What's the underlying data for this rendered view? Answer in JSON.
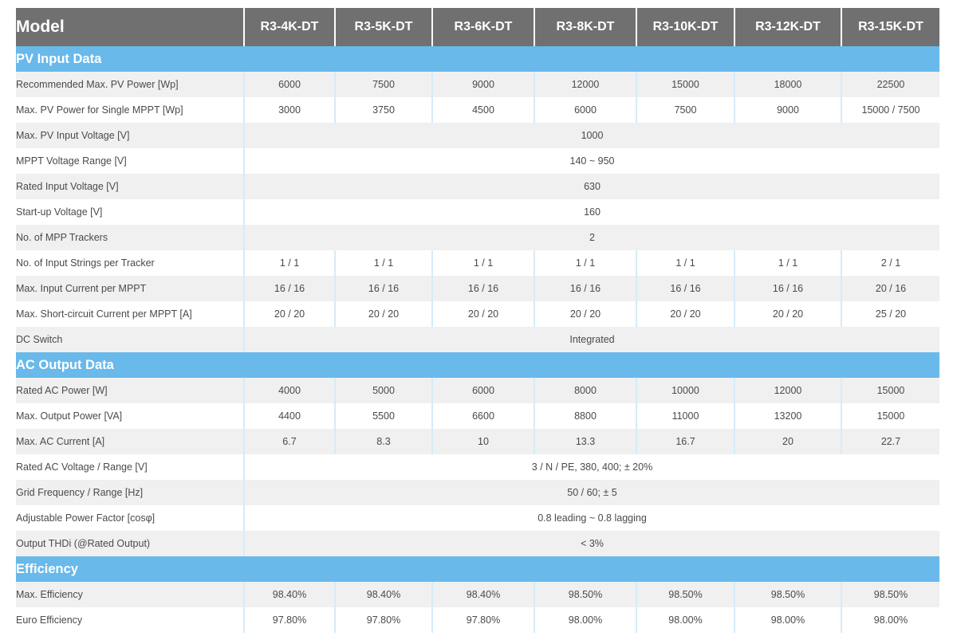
{
  "header": {
    "model_label": "Model",
    "models": [
      "R3-4K-DT",
      "R3-5K-DT",
      "R3-6K-DT",
      "R3-8K-DT",
      "R3-10K-DT",
      "R3-12K-DT",
      "R3-15K-DT"
    ]
  },
  "sections": [
    {
      "title": "PV Input Data",
      "rows": [
        {
          "label": "Recommended Max. PV Power [Wp]",
          "values": [
            "6000",
            "7500",
            "9000",
            "12000",
            "15000",
            "18000",
            "22500"
          ]
        },
        {
          "label": "Max. PV Power for Single MPPT [Wp]",
          "values": [
            "3000",
            "3750",
            "4500",
            "6000",
            "7500",
            "9000",
            "15000 / 7500"
          ]
        },
        {
          "label": "Max. PV Input Voltage [V]",
          "values": [
            "1000"
          ]
        },
        {
          "label": "MPPT Voltage Range [V]",
          "values": [
            "140 ~ 950"
          ]
        },
        {
          "label": "Rated Input Voltage [V]",
          "values": [
            "630"
          ]
        },
        {
          "label": "Start-up Voltage [V]",
          "values": [
            "160"
          ]
        },
        {
          "label": "No. of MPP Trackers",
          "values": [
            "2"
          ]
        },
        {
          "label": "No. of Input Strings per Tracker",
          "values": [
            "1 / 1",
            "1 / 1",
            "1 / 1",
            "1 / 1",
            "1 / 1",
            "1 / 1",
            "2 / 1"
          ]
        },
        {
          "label": "Max. Input Current per MPPT",
          "values": [
            "16 / 16",
            "16 / 16",
            "16 / 16",
            "16 / 16",
            "16 / 16",
            "16 / 16",
            "20 / 16"
          ]
        },
        {
          "label": "Max. Short-circuit Current per MPPT [A]",
          "values": [
            "20 / 20",
            "20 / 20",
            "20 / 20",
            "20 / 20",
            "20 / 20",
            "20 / 20",
            "25 / 20"
          ]
        },
        {
          "label": "DC Switch",
          "values": [
            "Integrated"
          ]
        }
      ]
    },
    {
      "title": "AC Output Data",
      "rows": [
        {
          "label": "Rated AC Power [W]",
          "values": [
            "4000",
            "5000",
            "6000",
            "8000",
            "10000",
            "12000",
            "15000"
          ]
        },
        {
          "label": "Max. Output Power [VA]",
          "values": [
            "4400",
            "5500",
            "6600",
            "8800",
            "11000",
            "13200",
            "15000"
          ]
        },
        {
          "label": "Max. AC Current [A]",
          "values": [
            "6.7",
            "8.3",
            "10",
            "13.3",
            "16.7",
            "20",
            "22.7"
          ]
        },
        {
          "label": "Rated AC Voltage / Range [V]",
          "values": [
            "3 / N / PE, 380, 400; ± 20%"
          ]
        },
        {
          "label": "Grid Frequency / Range [Hz]",
          "values": [
            "50 / 60; ± 5"
          ]
        },
        {
          "label": "Adjustable Power Factor [cosφ]",
          "values": [
            "0.8 leading ~ 0.8 lagging"
          ]
        },
        {
          "label": "Output THDi (@Rated Output)",
          "values": [
            "< 3%"
          ]
        }
      ]
    },
    {
      "title": "Efficiency",
      "rows": [
        {
          "label": "Max. Efficiency",
          "values": [
            "98.40%",
            "98.40%",
            "98.40%",
            "98.50%",
            "98.50%",
            "98.50%",
            "98.50%"
          ]
        },
        {
          "label": "Euro Efficiency",
          "values": [
            "97.80%",
            "97.80%",
            "97.80%",
            "98.00%",
            "98.00%",
            "98.00%",
            "98.00%"
          ]
        }
      ]
    }
  ]
}
